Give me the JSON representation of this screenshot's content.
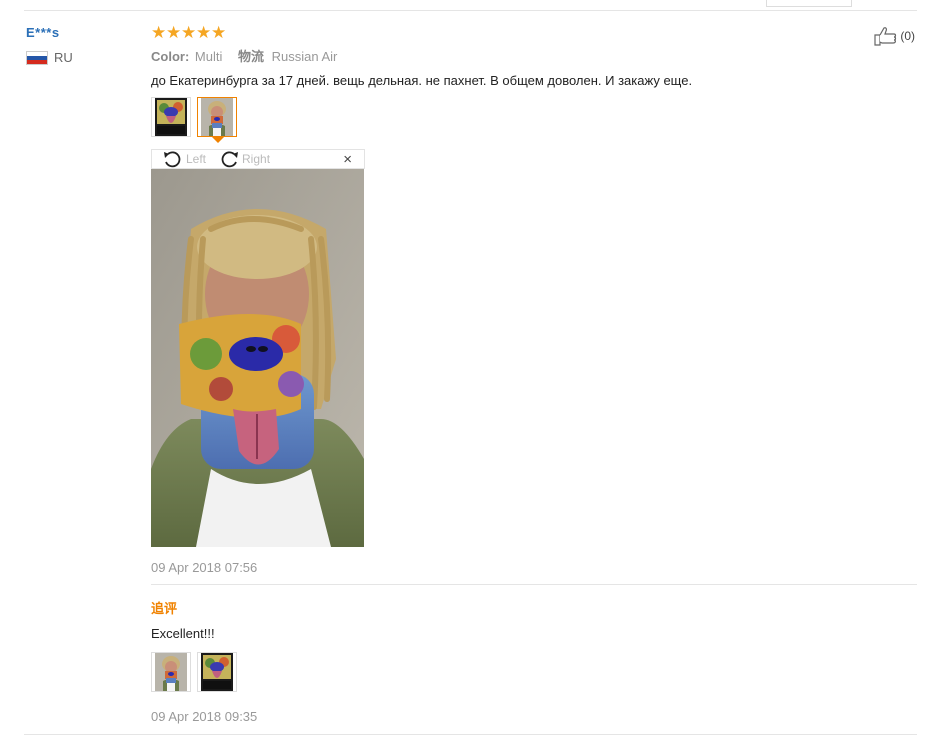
{
  "reviewer": {
    "name": "E***s",
    "country": "RU"
  },
  "review": {
    "rating": 5,
    "color_label": "Color:",
    "color_value": "Multi",
    "shipping_label": "物流",
    "shipping_value": "Russian Air",
    "text": "до Екатеринбурга за 17 дней. вещь дельная. не пахнет. В общем доволен. И закажу еще.",
    "date": "09 Apr 2018 07:56",
    "helpful_count": "(0)"
  },
  "viewer": {
    "rotate_left": "Left",
    "rotate_right": "Right",
    "close": "×"
  },
  "followup": {
    "label": "追评",
    "text": "Excellent!!!",
    "date": "09 Apr 2018 09:35"
  },
  "colors": {
    "accent": "#f08200",
    "star": "#f5a623",
    "username": "#2a6fb7"
  },
  "icons": [
    "russia-flag-icon",
    "thumbs-up-icon",
    "rotate-left-icon",
    "rotate-right-icon",
    "close-icon",
    "star-icon"
  ]
}
